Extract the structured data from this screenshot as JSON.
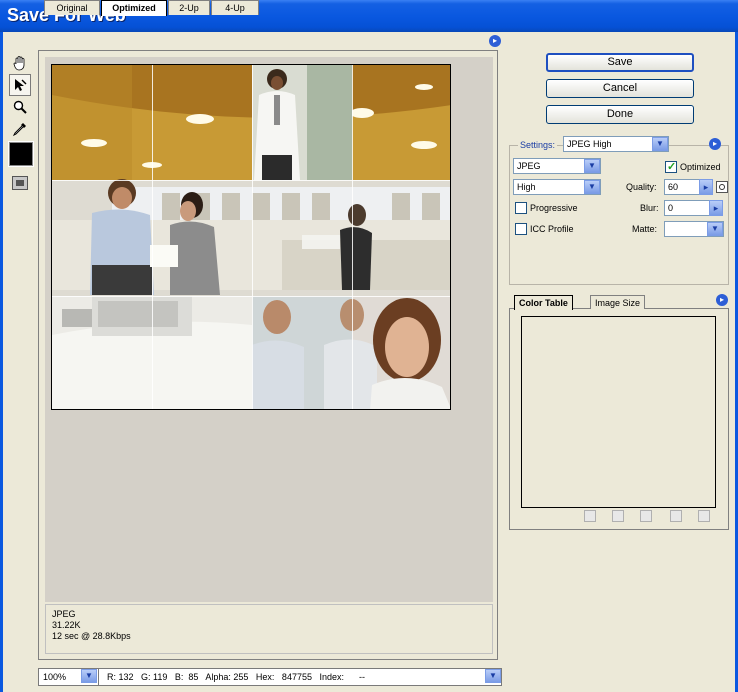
{
  "window": {
    "title": "Save For Web"
  },
  "tabs": [
    {
      "label": "Original"
    },
    {
      "label": "Optimized"
    },
    {
      "label": "2-Up"
    },
    {
      "label": "4-Up"
    }
  ],
  "tools": [
    "hand-icon",
    "slice-select-icon",
    "zoom-icon",
    "eyedropper-icon"
  ],
  "buttons": {
    "save": "Save",
    "cancel": "Cancel",
    "done": "Done"
  },
  "settings": {
    "label": "Settings:",
    "preset": "JPEG High",
    "format": "JPEG",
    "quality_level": "High",
    "optimized_label": "Optimized",
    "optimized_checked": true,
    "quality_label": "Quality:",
    "quality_value": "60",
    "progressive_label": "Progressive",
    "progressive_checked": false,
    "blur_label": "Blur:",
    "blur_value": "0",
    "icc_label": "ICC Profile",
    "icc_checked": false,
    "matte_label": "Matte:",
    "matte_value": ""
  },
  "panel_tabs": {
    "color_table": "Color Table",
    "image_size": "Image Size"
  },
  "info": {
    "format": "JPEG",
    "size": "31.22K",
    "time": "12 sec @ 28.8Kbps"
  },
  "status": {
    "zoom": "100%",
    "readout": "R: 132   G: 119   B:  85   Alpha: 255   Hex:   847755   Index:      --"
  }
}
